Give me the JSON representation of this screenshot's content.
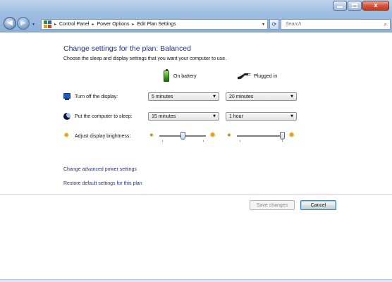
{
  "window": {
    "minimize_label": "",
    "maximize_label": "",
    "close_glyph": "x"
  },
  "nav": {
    "back_glyph": "◀",
    "forward_glyph": "▶",
    "recent_glyph": "▾",
    "refresh_glyph": "⟳"
  },
  "address_bar": {
    "icon": "control-panel-icon",
    "sep": "▸",
    "breadcrumbs": [
      "Control Panel",
      "Power Options",
      "Edit Plan Settings"
    ],
    "dropdown_glyph": "▾"
  },
  "search": {
    "placeholder": "Search",
    "icon_glyph": "⌕"
  },
  "page": {
    "heading": "Change settings for the plan: Balanced",
    "subheading": "Choose the sleep and display settings that you want your computer to use."
  },
  "columns": {
    "on_battery": "On battery",
    "plugged_in": "Plugged in"
  },
  "settings": {
    "display": {
      "label": "Turn off the display:",
      "on_battery": "5 minutes",
      "plugged_in": "20 minutes"
    },
    "sleep": {
      "label": "Put the computer to sleep:",
      "on_battery": "15 minutes",
      "plugged_in": "1 hour"
    },
    "brightness": {
      "label": "Adjust display brightness:",
      "on_battery_level": 0.5,
      "plugged_in_level": 1.0
    }
  },
  "links": {
    "advanced": "Change advanced power settings",
    "restore": "Restore default settings for this plan"
  },
  "buttons": {
    "save": "Save changes",
    "cancel": "Cancel"
  },
  "icons": {
    "sun_glyph": "✹",
    "dropdown_arrow": "▼"
  },
  "colors": {
    "link": "#1e3287",
    "heading": "#1e3287",
    "battery": "#38a21a",
    "sun": "#e4a414"
  }
}
